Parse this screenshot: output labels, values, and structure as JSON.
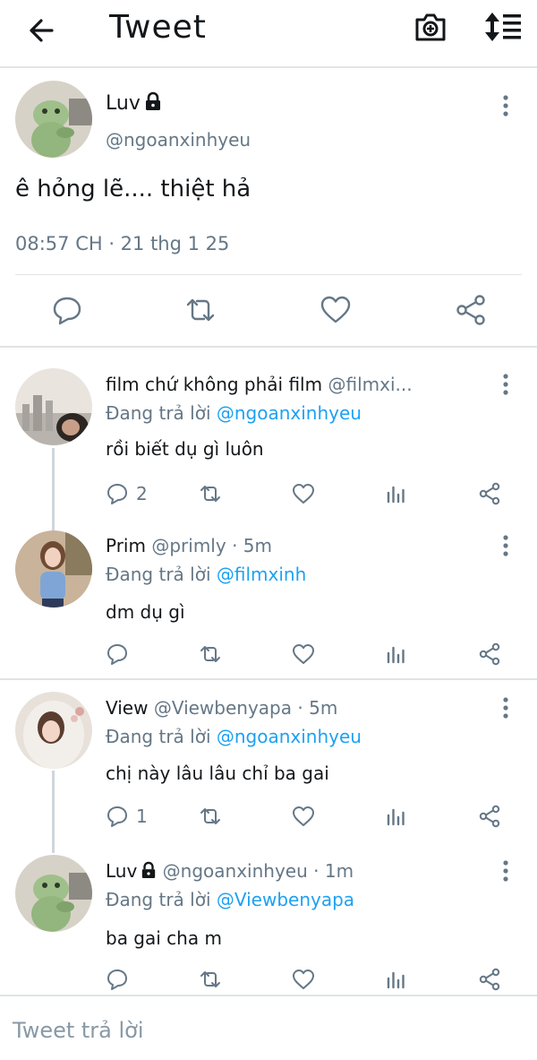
{
  "header": {
    "title": "Tweet",
    "back_icon": "arrow-left-icon",
    "camera_icon": "camera-plus-icon",
    "sort_icon": "sort-icon"
  },
  "main_tweet": {
    "name": "Luv",
    "handle": "@ngoanxinhyeu",
    "text": "ê hỏng lẽ.... thiệt hả",
    "time": "08:57 CH · 21 thg 1 25"
  },
  "replies": [
    {
      "name": "film chứ không phải film",
      "handle": "@filmxi...",
      "time": "",
      "replying_to_label": "Đang trả lời",
      "replying_to": "@ngoanxinhyeu",
      "text": "rồi biết dụ gì luôn",
      "reply_count": "2"
    },
    {
      "name": "Prim",
      "handle": "@primly",
      "time": "· 5m",
      "replying_to_label": "Đang trả lời",
      "replying_to": "@filmxinh",
      "text": "dm dụ gì",
      "reply_count": ""
    },
    {
      "name": "View",
      "handle": "@Viewbenyapa",
      "time": "· 5m",
      "replying_to_label": "Đang trả lời",
      "replying_to": "@ngoanxinhyeu",
      "text": "chị này lâu lâu chỉ ba gai",
      "reply_count": "1"
    },
    {
      "name": "Luv",
      "handle": "@ngoanxinhyeu",
      "time": "· 1m",
      "replying_to_label": "Đang trả lời",
      "replying_to": "@Viewbenyapa",
      "text": "ba gai cha m",
      "reply_count": ""
    }
  ],
  "composer": {
    "placeholder": "Tweet trả lời"
  },
  "colors": {
    "accent": "#1da1f2",
    "muted": "#657786",
    "divider": "#e1e4e6"
  }
}
